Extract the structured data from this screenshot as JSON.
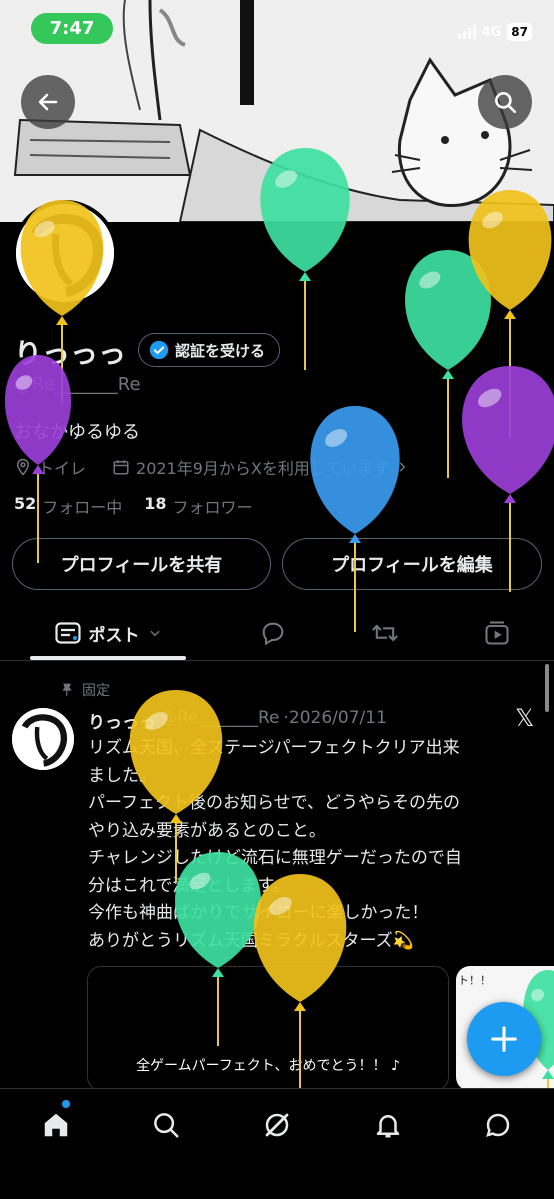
{
  "status_bar": {
    "time": "7:47",
    "network": "4G",
    "battery": "87"
  },
  "profile": {
    "name": "りっっっ",
    "verify_label": "認証を受ける",
    "handle": "@Re_______Re",
    "bio": "おなかゆるゆる",
    "location": "トイレ",
    "joined": "2021年9月からXを利用しています",
    "following_count": "52",
    "following_label": "フォロー中",
    "followers_count": "18",
    "followers_label": "フォロワー",
    "share_label": "プロフィールを共有",
    "edit_label": "プロフィールを編集"
  },
  "tabs": {
    "posts_label": "ポスト"
  },
  "post": {
    "pinned_label": "固定",
    "author": "りっっっ",
    "handle": "@Re_______Re",
    "date": "·2026/07/11",
    "text": "リズム天国、全ステージパーフェクトクリア出来\nました。\nパーフェクト後のお知らせで、どうやらその先の\nやり込み要素があるとのこと。\nチャレンジしたけど流石に無理ゲーだったので自\n分はこれで満足とします。\n今作も神曲ばかりでサイコーに楽しかった！\nありがとうリズム天国ミラクルスターズ💫",
    "media_caption": "全ゲームパーフェクト、おめでとう！！",
    "media2_caption": "ト！！"
  },
  "colors": {
    "accent": "#1d9bf0",
    "status_pill": "#34c759",
    "background": "#000000",
    "secondary_text": "#71767b"
  },
  "icons": [
    "arrow-left-icon",
    "search-icon",
    "verified-badge-icon",
    "location-icon",
    "calendar-icon",
    "chevron-right-icon",
    "posts-icon",
    "chevron-down-icon",
    "reply-icon",
    "repost-icon",
    "media-icon",
    "pin-icon",
    "x-logo-icon",
    "plus-icon",
    "home-icon",
    "explore-icon",
    "grok-icon",
    "notifications-icon",
    "messages-icon"
  ]
}
